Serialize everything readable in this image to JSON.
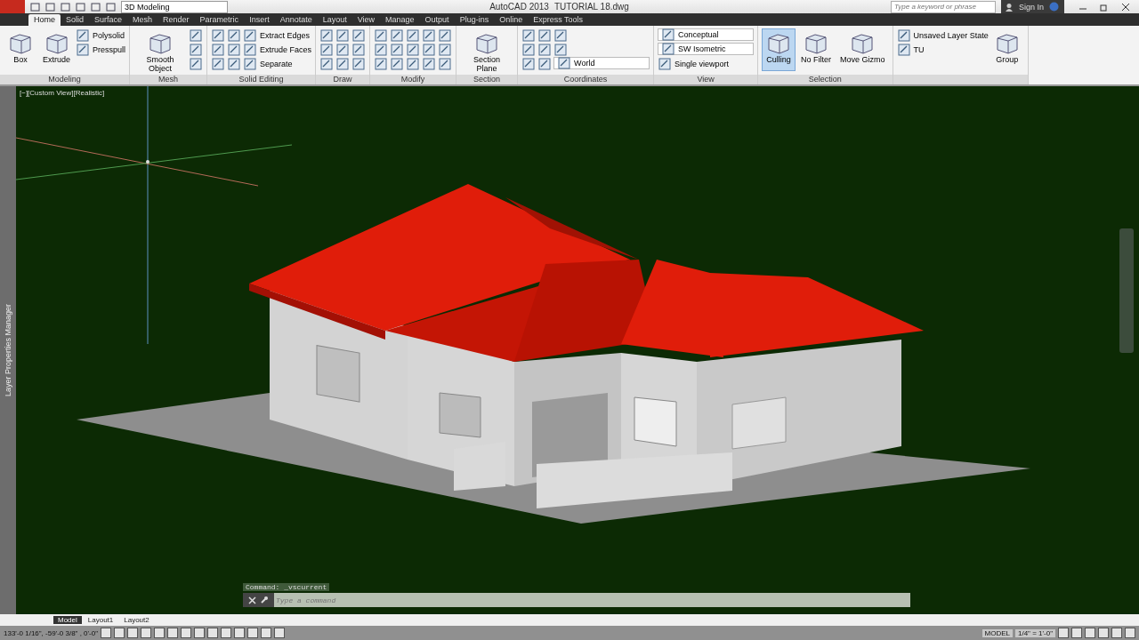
{
  "title_bar": {
    "workspace": "3D Modeling",
    "app": "AutoCAD 2013",
    "file": "TUTORIAL 18.dwg",
    "search": {
      "placeholder": "Type a keyword or phrase"
    },
    "sign_in": "Sign In"
  },
  "tabs": [
    {
      "label": "Home",
      "selected": true
    },
    {
      "label": "Solid",
      "selected": false
    },
    {
      "label": "Surface",
      "selected": false
    },
    {
      "label": "Mesh",
      "selected": false
    },
    {
      "label": "Render",
      "selected": false
    },
    {
      "label": "Parametric",
      "selected": false
    },
    {
      "label": "Insert",
      "selected": false
    },
    {
      "label": "Annotate",
      "selected": false
    },
    {
      "label": "Layout",
      "selected": false
    },
    {
      "label": "View",
      "selected": false
    },
    {
      "label": "Manage",
      "selected": false
    },
    {
      "label": "Output",
      "selected": false
    },
    {
      "label": "Plug-ins",
      "selected": false
    },
    {
      "label": "Online",
      "selected": false
    },
    {
      "label": "Express Tools",
      "selected": false
    }
  ],
  "panels": [
    {
      "title": "Modeling",
      "items": [
        {
          "kind": "large",
          "label": "Box",
          "selected": false
        },
        {
          "kind": "large",
          "label": "Extrude",
          "selected": false
        },
        {
          "kind": "small",
          "label": "Polysolid"
        },
        {
          "kind": "small",
          "label": "Presspull"
        }
      ]
    },
    {
      "title": "Mesh",
      "items": [
        {
          "kind": "large",
          "label": "Smooth Object",
          "selected": false
        },
        {
          "kind": "icon"
        },
        {
          "kind": "icon"
        },
        {
          "kind": "icon"
        }
      ]
    },
    {
      "title": "Solid Editing",
      "items": [
        {
          "kind": "icon"
        },
        {
          "kind": "icon"
        },
        {
          "kind": "icon"
        },
        {
          "kind": "icon"
        },
        {
          "kind": "icon"
        },
        {
          "kind": "icon"
        },
        {
          "kind": "small",
          "label": "Extract Edges"
        },
        {
          "kind": "small",
          "label": "Extrude Faces"
        },
        {
          "kind": "small",
          "label": "Separate"
        }
      ]
    },
    {
      "title": "Draw",
      "items": [
        {
          "kind": "icon"
        },
        {
          "kind": "icon"
        },
        {
          "kind": "icon"
        },
        {
          "kind": "icon"
        },
        {
          "kind": "icon"
        },
        {
          "kind": "icon"
        },
        {
          "kind": "icon"
        },
        {
          "kind": "icon"
        },
        {
          "kind": "icon"
        }
      ]
    },
    {
      "title": "Modify",
      "items": [
        {
          "kind": "icon"
        },
        {
          "kind": "icon"
        },
        {
          "kind": "icon"
        },
        {
          "kind": "icon"
        },
        {
          "kind": "icon"
        },
        {
          "kind": "icon"
        },
        {
          "kind": "icon"
        },
        {
          "kind": "icon"
        },
        {
          "kind": "icon"
        },
        {
          "kind": "icon"
        },
        {
          "kind": "icon"
        },
        {
          "kind": "icon"
        },
        {
          "kind": "icon"
        },
        {
          "kind": "icon"
        },
        {
          "kind": "icon"
        }
      ]
    },
    {
      "title": "Section",
      "items": [
        {
          "kind": "large",
          "label": "Section Plane",
          "selected": false
        }
      ]
    },
    {
      "title": "Coordinates",
      "items": [
        {
          "kind": "icon"
        },
        {
          "kind": "icon"
        },
        {
          "kind": "icon"
        },
        {
          "kind": "icon"
        },
        {
          "kind": "icon"
        },
        {
          "kind": "icon"
        },
        {
          "kind": "icon"
        },
        {
          "kind": "icon"
        },
        {
          "kind": "dropdown",
          "label": "World"
        }
      ]
    },
    {
      "title": "View",
      "items": [
        {
          "kind": "dropdown",
          "label": "Conceptual"
        },
        {
          "kind": "dropdown",
          "label": "SW Isometric"
        },
        {
          "kind": "small",
          "label": "Single viewport"
        }
      ]
    },
    {
      "title": "Selection",
      "items": [
        {
          "kind": "large",
          "label": "Culling",
          "selected": true
        },
        {
          "kind": "large",
          "label": "No Filter",
          "selected": false
        },
        {
          "kind": "large",
          "label": "Move Gizmo",
          "selected": false
        }
      ]
    },
    {
      "items": [
        {
          "kind": "small",
          "label": "Unsaved Layer State"
        },
        {
          "kind": "small",
          "label": "TU"
        },
        {
          "kind": "large",
          "label": "Group",
          "selected": false
        }
      ]
    }
  ],
  "viewport": {
    "label": "[−][Custom View][Realistic]",
    "palette": "Layer Properties Manager"
  },
  "command_line": {
    "history": "Command: _vscurrent",
    "input": {
      "placeholder": "Type a command"
    }
  },
  "layout_tabs": [
    {
      "label": "Model",
      "selected": true
    },
    {
      "label": "Layout1",
      "selected": false
    },
    {
      "label": "Layout2",
      "selected": false
    }
  ],
  "status_bar": {
    "coordinates": "133'-0 1/16\", -59'-0 3/8\" , 0'-0\"",
    "space": "MODEL",
    "scale": "1/4\" = 1'-0\""
  }
}
